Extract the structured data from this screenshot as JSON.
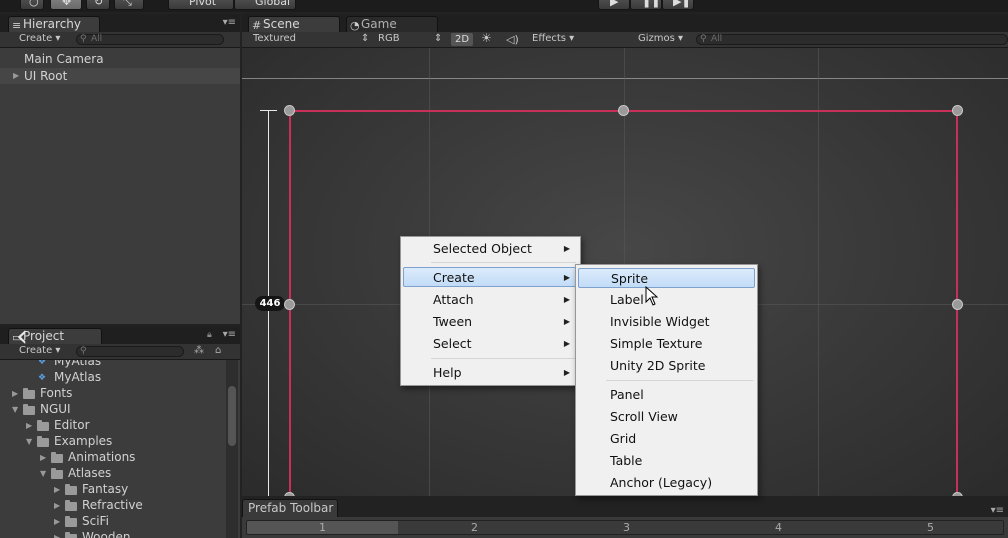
{
  "toolbar": {
    "pivot_label": "Pivot",
    "global_label": "Global"
  },
  "hierarchy": {
    "tab_label": "Hierarchy",
    "create_label": "Create",
    "search_placeholder": "All",
    "items": [
      "Main Camera",
      "UI Root"
    ]
  },
  "project": {
    "tab_label": "Project",
    "create_label": "Create",
    "tree": [
      {
        "label": "MyAtlas",
        "depth": 1
      },
      {
        "label": "MyAtlas",
        "depth": 1
      },
      {
        "label": "Fonts",
        "depth": 0
      },
      {
        "label": "NGUI",
        "depth": 0
      },
      {
        "label": "Editor",
        "depth": 1
      },
      {
        "label": "Examples",
        "depth": 1
      },
      {
        "label": "Animations",
        "depth": 2
      },
      {
        "label": "Atlases",
        "depth": 2
      },
      {
        "label": "Fantasy",
        "depth": 3
      },
      {
        "label": "Refractive",
        "depth": 3
      },
      {
        "label": "SciFi",
        "depth": 3
      },
      {
        "label": "Wooden",
        "depth": 3
      }
    ]
  },
  "scene": {
    "tabs": [
      "Scene",
      "Game"
    ],
    "shading_mode": "Textured",
    "render_mode": "RGB",
    "mode_2d": "2D",
    "effects_label": "Effects",
    "gizmos_label": "Gizmos",
    "search_placeholder": "All",
    "height_label": "446"
  },
  "context_menu": {
    "items": [
      "Selected Object",
      "Create",
      "Attach",
      "Tween",
      "Select",
      "Help"
    ],
    "highlighted": "Create"
  },
  "create_submenu": {
    "group1": [
      "Sprite",
      "Label",
      "Invisible Widget",
      "Simple Texture",
      "Unity 2D Sprite"
    ],
    "group2": [
      "Panel",
      "Scroll View",
      "Grid",
      "Table",
      "Anchor (Legacy)"
    ],
    "highlighted": "Sprite"
  },
  "prefab_toolbar": {
    "tab_label": "Prefab Toolbar",
    "pages": [
      "1",
      "2",
      "3",
      "4",
      "5"
    ]
  },
  "colors": {
    "selection_red": "#c8305a",
    "menu_highlight": "#c2dcf7"
  }
}
